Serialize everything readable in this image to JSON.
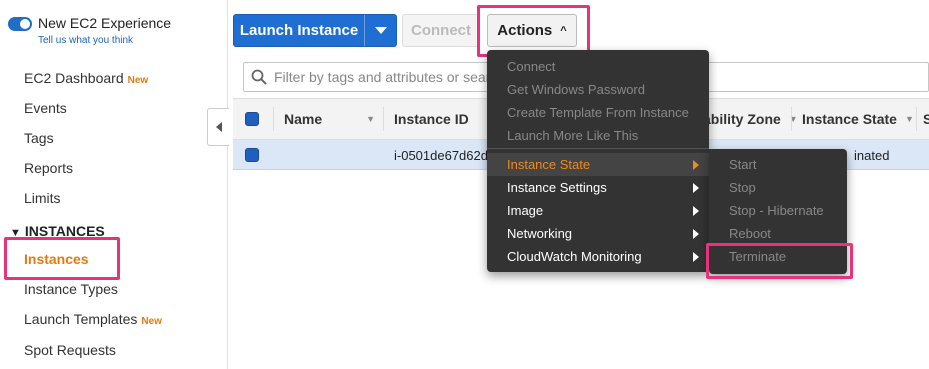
{
  "sidebar": {
    "toggle_title": "New EC2 Experience",
    "toggle_link": "Tell us what you think",
    "items": [
      {
        "label": "EC2 Dashboard",
        "badge": "New"
      },
      {
        "label": "Events"
      },
      {
        "label": "Tags"
      },
      {
        "label": "Reports"
      },
      {
        "label": "Limits"
      }
    ],
    "section_title": "INSTANCES",
    "section_items": [
      {
        "label": "Instances"
      },
      {
        "label": "Instance Types"
      },
      {
        "label": "Launch Templates",
        "badge": "New"
      },
      {
        "label": "Spot Requests"
      }
    ]
  },
  "toolbar": {
    "launch_label": "Launch Instance",
    "connect_label": "Connect",
    "actions_label": "Actions"
  },
  "filter": {
    "placeholder": "Filter by tags and attributes or search"
  },
  "table": {
    "columns": [
      "Name",
      "Instance ID",
      "ability Zone",
      "Instance State",
      "S"
    ],
    "rows": [
      {
        "instance_id": "i-0501de67d62d",
        "state": "inated"
      }
    ]
  },
  "actions_menu": {
    "items": [
      {
        "label": "Connect",
        "state": "disabled"
      },
      {
        "label": "Get Windows Password",
        "state": "disabled"
      },
      {
        "label": "Create Template From Instance",
        "state": "disabled"
      },
      {
        "label": "Launch More Like This",
        "state": "disabled"
      },
      {
        "label": "Instance State",
        "state": "active"
      },
      {
        "label": "Instance Settings",
        "state": "enabled"
      },
      {
        "label": "Image",
        "state": "enabled"
      },
      {
        "label": "Networking",
        "state": "enabled"
      },
      {
        "label": "CloudWatch Monitoring",
        "state": "enabled"
      }
    ]
  },
  "instance_state_submenu": {
    "items": [
      "Start",
      "Stop",
      "Stop - Hibernate",
      "Reboot",
      "Terminate"
    ]
  },
  "colors": {
    "primary": "#1f6ed4",
    "accent_orange": "#e47911",
    "highlight": "#e8337c",
    "menu_bg": "#333333"
  }
}
